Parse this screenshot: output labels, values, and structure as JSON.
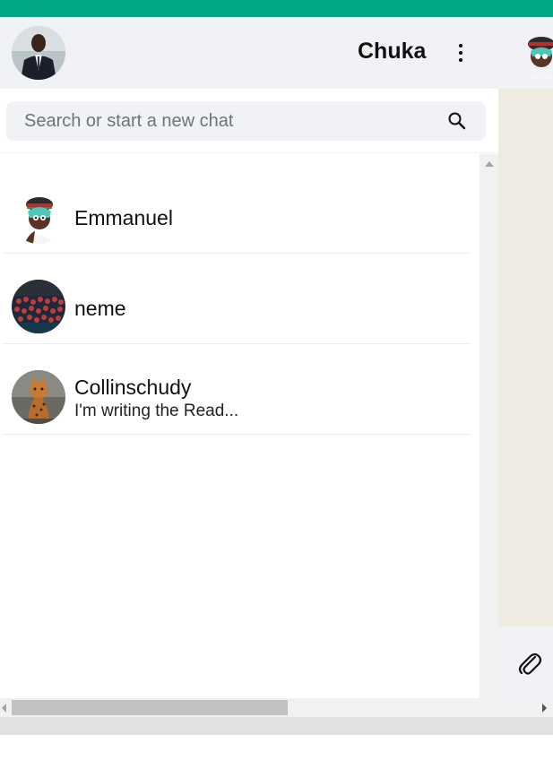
{
  "header": {
    "contact_name": "Chuka",
    "menu_icon": "kebab-menu-icon",
    "my_avatar": "user-avatar-photo",
    "contact_avatar": "cartoon-avatar"
  },
  "search": {
    "placeholder": "Search or start a new chat",
    "value": "",
    "icon": "search-icon"
  },
  "chats": [
    {
      "name": "Emmanuel",
      "preview": "",
      "avatar": "cartoon-avatar"
    },
    {
      "name": "neme",
      "preview": "",
      "avatar": "crowd-photo"
    },
    {
      "name": "Collinschudy",
      "preview": "I'm writing the Read...",
      "avatar": "leopard-photo"
    }
  ],
  "composer": {
    "attach_icon": "paperclip-icon"
  },
  "colors": {
    "accent": "#00a884",
    "panel_bg": "#f0f2f5",
    "chat_bg": "#efeae2"
  }
}
